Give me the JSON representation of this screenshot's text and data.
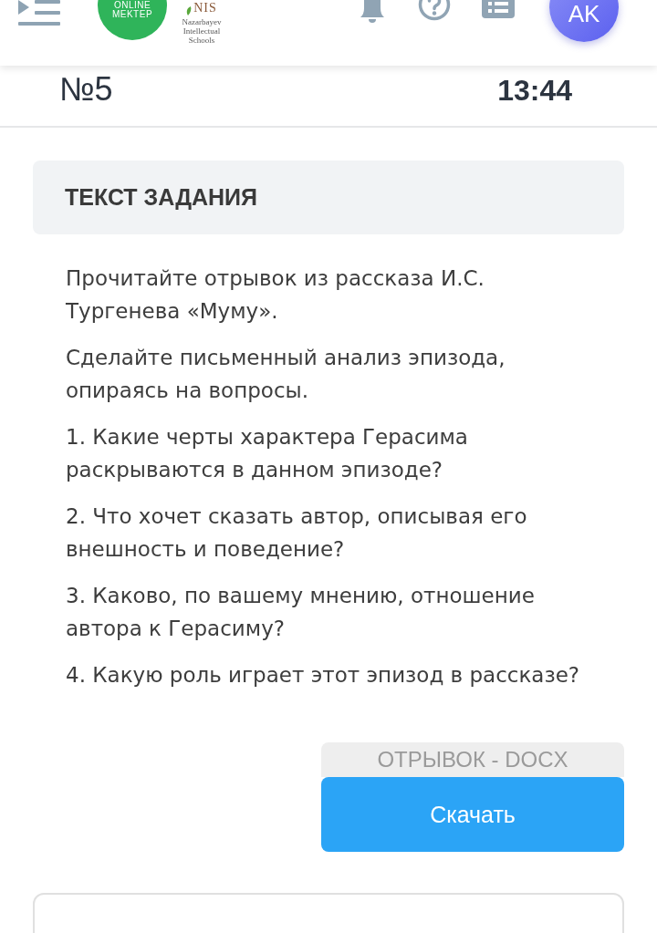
{
  "header": {
    "logo_text": "ONLINE MEKTEP",
    "partner_mark": "NIS",
    "partner_caption": "Nazarbayev Intellectual Schools",
    "avatar_initials": "AK"
  },
  "info": {
    "number": "№5",
    "time": "13:44"
  },
  "task": {
    "title": "ТЕКСТ ЗАДАНИЯ",
    "paragraphs": [
      "Прочитайте отрывок из рассказа И.С. Тургенева «Муму».",
      "Сделайте письменный анализ эпизода, опираясь на вопросы.",
      "1. Какие черты характера Герасима раскрываются в данном эпизоде?",
      "2. Что хочет сказать автор, описывая его внешность и поведение?",
      "3. Каково, по вашему мнению, отношение автора к Герасиму?",
      "4. Какую роль играет этот эпизод в рассказе?"
    ]
  },
  "attachment": {
    "file_label": "ОТРЫВОК - DOCX",
    "button": "Скачать"
  }
}
